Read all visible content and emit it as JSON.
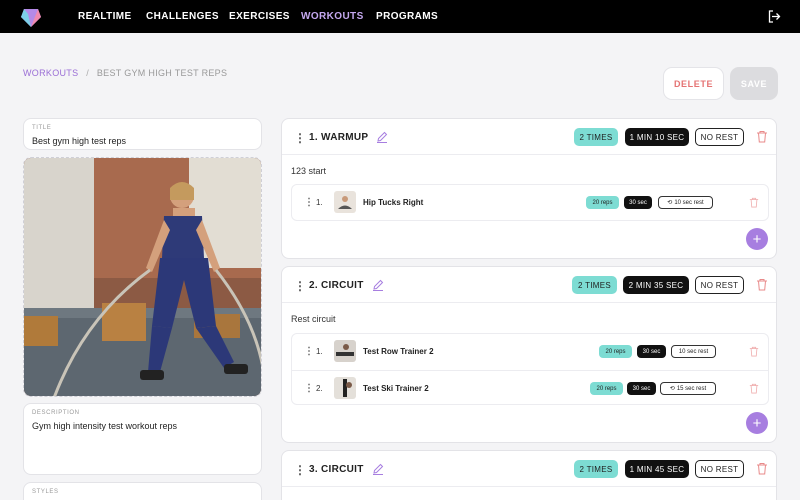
{
  "nav": {
    "items": [
      {
        "label": "REALTIME"
      },
      {
        "label": "CHALLENGES"
      },
      {
        "label": "EXERCISES"
      },
      {
        "label": "WORKOUTS"
      },
      {
        "label": "PROGRAMS"
      }
    ],
    "active": "WORKOUTS",
    "logout_icon": "logout-icon",
    "logo_icon": "brand-logo"
  },
  "breadcrumb": {
    "parent": "WORKOUTS",
    "separator": "/",
    "current": "BEST GYM HIGH TEST REPS"
  },
  "actions": {
    "delete_label": "DELETE",
    "save_label": "SAVE"
  },
  "form": {
    "title_label": "TITLE",
    "title_value": "Best gym high test reps",
    "description_label": "DESCRIPTION",
    "description_value": "Gym high intensity test workout reps",
    "styles_label": "STYLES"
  },
  "sections": [
    {
      "title": "1. WARMUP",
      "times": "2 TIMES",
      "duration": "1 MIN 10 SEC",
      "rest": "NO REST",
      "description": "123 start",
      "exercises": [
        {
          "num": "1.",
          "name": "Hip Tucks Right",
          "reps": "20 reps",
          "duration": "30 sec",
          "rest": "10 sec rest"
        }
      ]
    },
    {
      "title": "2. CIRCUIT",
      "times": "2 TIMES",
      "duration": "2 MIN 35 SEC",
      "rest": "NO REST",
      "description": "Rest circuit",
      "exercises": [
        {
          "num": "1.",
          "name": "Test Row Trainer 2",
          "reps": "20 reps",
          "duration": "30 sec",
          "rest": "10 sec rest"
        },
        {
          "num": "2.",
          "name": "Test Ski Trainer 2",
          "reps": "20 reps",
          "duration": "30 sec",
          "rest": "15 sec rest"
        }
      ]
    },
    {
      "title": "3. CIRCUIT",
      "times": "2 TIMES",
      "duration": "1 MIN 45 SEC",
      "rest": "NO REST"
    }
  ],
  "colors": {
    "accent": "#a77ee0",
    "teal": "#7ddcd3",
    "danger": "#e57373"
  }
}
